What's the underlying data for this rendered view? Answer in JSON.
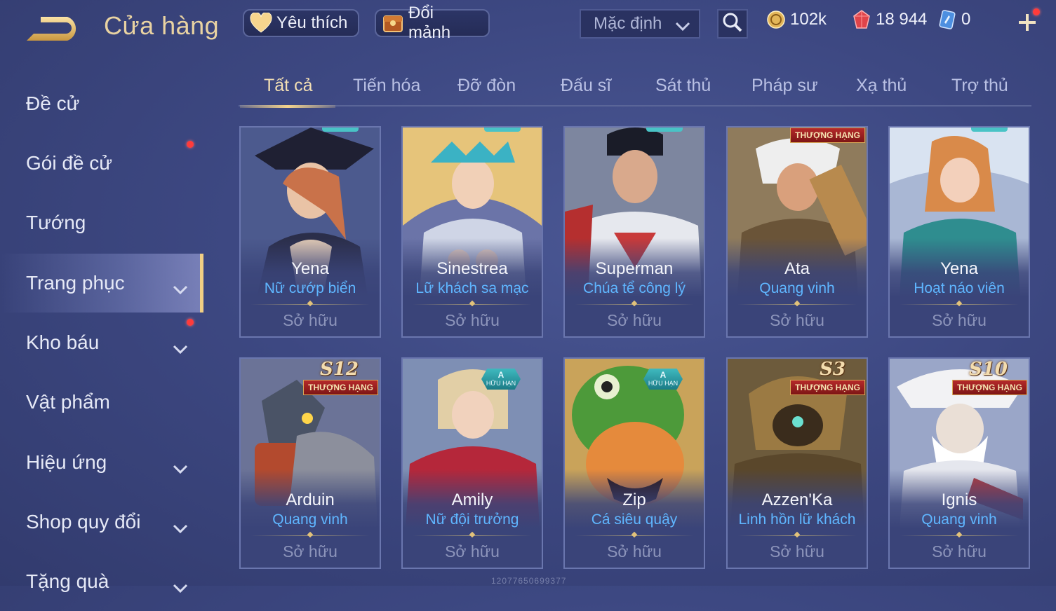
{
  "header": {
    "title": "Cửa hàng",
    "favorite_label": "Yêu thích",
    "shard_exchange_label": "Đổi mảnh",
    "sort": {
      "selected": "Mặc định"
    },
    "currencies": {
      "gold": "102k",
      "ruby": "18 944",
      "voucher": "0"
    }
  },
  "sidebar": {
    "items": [
      {
        "label": "Đề cử"
      },
      {
        "label": "Gói đề cử"
      },
      {
        "label": "Tướng"
      },
      {
        "label": "Trang phục"
      },
      {
        "label": "Kho báu"
      },
      {
        "label": "Vật phẩm"
      },
      {
        "label": "Hiệu ứng"
      },
      {
        "label": "Shop quy đổi"
      },
      {
        "label": "Tặng quà"
      }
    ],
    "active": "Trang phục"
  },
  "tabs": [
    {
      "label": "Tất cả"
    },
    {
      "label": "Tiến hóa"
    },
    {
      "label": "Đỡ đòn"
    },
    {
      "label": "Đấu sĩ"
    },
    {
      "label": "Sát thủ"
    },
    {
      "label": "Pháp sư"
    },
    {
      "label": "Xạ thủ"
    },
    {
      "label": "Trợ thủ"
    }
  ],
  "cards": [
    {
      "hero": "Yena",
      "skin": "Nữ cướp biển",
      "status": "Sở hữu"
    },
    {
      "hero": "Sinestrea",
      "skin": "Lữ khách sa mạc",
      "status": "Sở hữu"
    },
    {
      "hero": "Superman",
      "skin": "Chúa tể công lý",
      "status": "Sở hữu"
    },
    {
      "hero": "Ata",
      "skin": "Quang vinh",
      "status": "Sở hữu",
      "ribbon": "THƯỢNG HẠNG"
    },
    {
      "hero": "Yena",
      "skin": "Hoạt náo viên",
      "status": "Sở hữu"
    },
    {
      "hero": "Arduin",
      "skin": "Quang vinh",
      "status": "Sở hữu",
      "ribbon": "THƯỢNG HẠNG",
      "season": "S12"
    },
    {
      "hero": "Amily",
      "skin": "Nữ đội trưởng",
      "status": "Sở hữu",
      "badge": {
        "grade": "A",
        "text": "HỮU HẠN"
      }
    },
    {
      "hero": "Zip",
      "skin": "Cá siêu quậy",
      "status": "Sở hữu",
      "badge": {
        "grade": "A",
        "text": "HỮU HẠN"
      }
    },
    {
      "hero": "Azzen'Ka",
      "skin": "Linh hồn lữ khách",
      "status": "Sở hữu",
      "ribbon": "THƯỢNG HẠNG",
      "season": "S3"
    },
    {
      "hero": "Ignis",
      "skin": "Quang vinh",
      "status": "Sở hữu",
      "ribbon": "THƯỢNG HẠNG",
      "season": "S10"
    }
  ],
  "watermark": "12077650699377",
  "colors": {
    "accent_gold": "#f3d38c",
    "skin_name_blue": "#5fb6ff",
    "notification_red": "#ff3b3b"
  }
}
